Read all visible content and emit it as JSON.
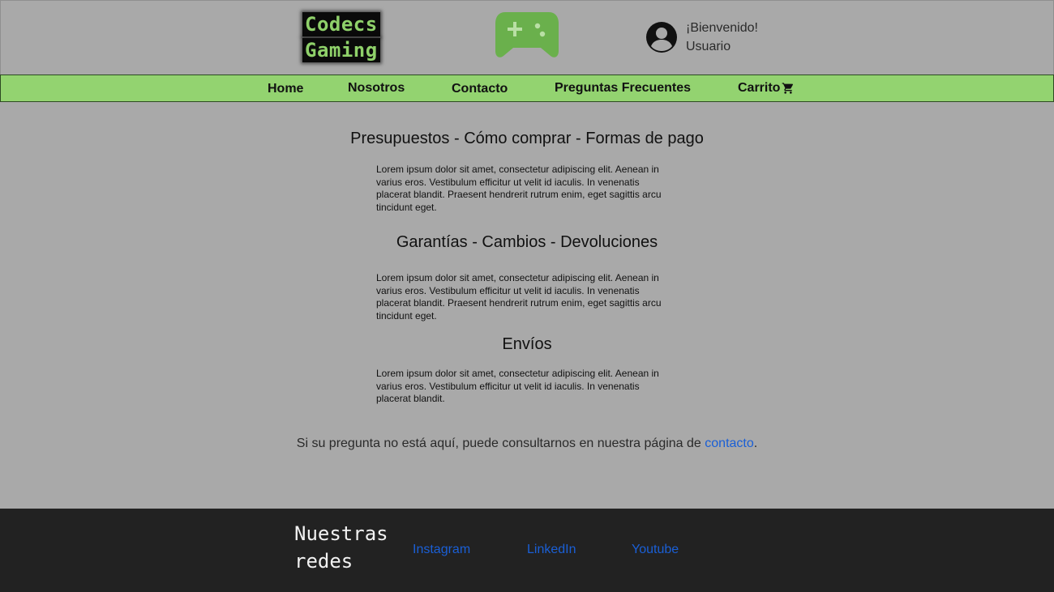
{
  "header": {
    "logo_line1": "Codecs",
    "logo_line2": "Gaming",
    "welcome": "¡Bienvenido!",
    "user": "Usuario"
  },
  "nav": {
    "items": [
      "Home",
      "Nosotros",
      "Contacto",
      "Preguntas Frecuentes",
      "Carrito"
    ]
  },
  "content": {
    "sections": [
      {
        "title": "Presupuestos - Cómo comprar - Formas de pago",
        "text": "Lorem ipsum dolor sit amet, consectetur adipiscing elit. Aenean in varius eros. Vestibulum efficitur ut velit id iaculis. In venenatis placerat blandit. Praesent hendrerit rutrum enim, eget sagittis arcu tincidunt eget."
      },
      {
        "title": "Garantías - Cambios - Devoluciones",
        "text": "Lorem ipsum dolor sit amet, consectetur adipiscing elit. Aenean in varius eros. Vestibulum efficitur ut velit id iaculis. In venenatis placerat blandit. Praesent hendrerit rutrum enim, eget sagittis arcu tincidunt eget."
      },
      {
        "title": "Envíos",
        "text": "Lorem ipsum dolor sit amet, consectetur adipiscing elit. Aenean in varius eros. Vestibulum efficitur ut velit id iaculis. In venenatis placerat blandit."
      }
    ],
    "note_prefix": "Si su pregunta no está aquí, puede consultarnos en nuestra página de ",
    "note_link": "contacto",
    "note_suffix": "."
  },
  "footer": {
    "title": "Nuestras redes",
    "links": [
      "Instagram",
      "LinkedIn",
      "Youtube"
    ]
  },
  "colors": {
    "background": "#a9a9a9",
    "nav": "#93d370",
    "accent_green": "#6ab04c",
    "footer": "#222222",
    "link": "#1a5fd6"
  }
}
